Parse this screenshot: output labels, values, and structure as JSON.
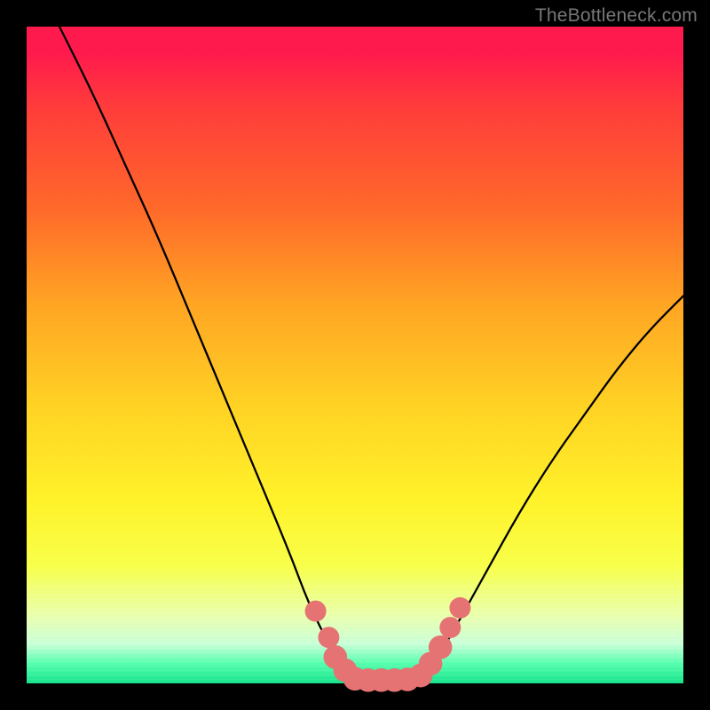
{
  "watermark": "TheBottleneck.com",
  "colors": {
    "background": "#000000",
    "curve": "#000000",
    "marker_fill": "#e57373",
    "marker_stroke": "#c94a4a"
  },
  "chart_data": {
    "type": "line",
    "title": "",
    "xlabel": "",
    "ylabel": "",
    "xlim": [
      0,
      100
    ],
    "ylim": [
      0,
      100
    ],
    "grid": false,
    "series": [
      {
        "name": "left-branch",
        "x": [
          5,
          10,
          15,
          20,
          25,
          30,
          35,
          40,
          43,
          46,
          48,
          50
        ],
        "values": [
          100,
          90,
          79,
          68,
          56,
          44,
          32,
          20,
          12,
          6,
          2,
          0.5
        ]
      },
      {
        "name": "floor",
        "x": [
          50,
          52,
          54,
          56,
          58,
          60
        ],
        "values": [
          0.5,
          0.3,
          0.3,
          0.3,
          0.3,
          0.5
        ]
      },
      {
        "name": "right-branch",
        "x": [
          60,
          62,
          65,
          70,
          75,
          80,
          85,
          90,
          95,
          100
        ],
        "values": [
          0.5,
          3,
          8,
          17,
          26,
          34,
          41,
          48,
          54,
          59
        ]
      }
    ],
    "markers": [
      {
        "x": 44,
        "y": 11,
        "r": 1.2
      },
      {
        "x": 46,
        "y": 7,
        "r": 1.2
      },
      {
        "x": 47,
        "y": 4,
        "r": 1.4
      },
      {
        "x": 48.5,
        "y": 2,
        "r": 1.4
      },
      {
        "x": 50,
        "y": 0.7,
        "r": 1.4
      },
      {
        "x": 52,
        "y": 0.5,
        "r": 1.4
      },
      {
        "x": 54,
        "y": 0.5,
        "r": 1.4
      },
      {
        "x": 56,
        "y": 0.5,
        "r": 1.4
      },
      {
        "x": 58,
        "y": 0.6,
        "r": 1.4
      },
      {
        "x": 60,
        "y": 1.2,
        "r": 1.4
      },
      {
        "x": 61.5,
        "y": 3,
        "r": 1.4
      },
      {
        "x": 63,
        "y": 5.5,
        "r": 1.4
      },
      {
        "x": 64.5,
        "y": 8.5,
        "r": 1.2
      },
      {
        "x": 66,
        "y": 11.5,
        "r": 1.2
      }
    ]
  }
}
